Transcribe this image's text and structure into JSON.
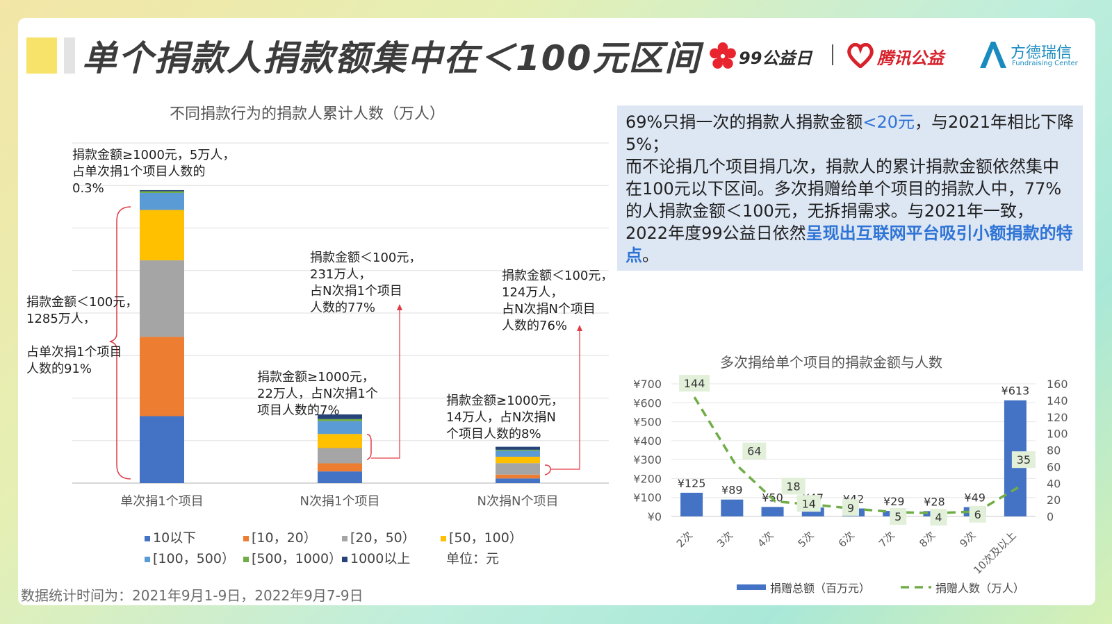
{
  "page": {
    "title": "单个捐款人捐款额集中在＜100元区间",
    "logos": {
      "text_99": "99公益日",
      "text_tencent": "腾讯公益",
      "text_fd": "方德瑞信",
      "text_fd_en": "Fundraising Center"
    },
    "footer": "数据统计时间为：2021年9月1-9日，2022年9月7-9日"
  },
  "summary_box": {
    "line1_a": "69%只捐一次的捐款人捐款金额",
    "line1_hl": "<20元",
    "line1_b": "，与2021年相比下降5%；",
    "line2_a": "而不论捐几个项目捐几次，捐款人的累计捐款金额依然集中在100元以下区间。多次捐赠给单个项目的捐款人中，77%的人捐款金额＜100元，无拆捐需求。与2021年一致，2022年度99公益日依然",
    "line2_hl": "呈现出互联网平台吸引小额捐款的特点",
    "line2_end": "。",
    "colors": {
      "box_bg": "#dde6f3",
      "highlight": "#2e74d6"
    }
  },
  "left_chart_text": {
    "title": "不同捐款行为的捐款人累计人数（万人）",
    "unit_label": "单位：元",
    "annotations": {
      "a1": "捐款金额≥1000元，5万人，\n占单次捐1个项目人数的\n0.3%",
      "a2": "捐款金额＜100元，\n1285万人，",
      "a3": "占单次捐1个项目\n人数的91%",
      "a4": "捐款金额＜100元，\n231万人，\n占N次捐1个项目\n人数的77%",
      "a5": "捐款金额≥1000元，\n22万人，占N次捐1个\n项目人数的7%",
      "a6": "捐款金额＜100元，\n124万人，\n占N次捐N个项目\n人数的76%",
      "a7": "捐款金额≥1000元，\n14万人，占N次捐N\n个项目人数的8%"
    }
  },
  "right_chart_text": {
    "title": "多次捐给单个项目的捐款金额与人数"
  },
  "chart_data": [
    {
      "type": "bar",
      "stacked": true,
      "title": "不同捐款行为的捐款人累计人数（万人）",
      "categories": [
        "单次捐1个项目",
        "N次捐1个项目",
        "N次捐N个项目"
      ],
      "series": [
        {
          "name": "10以下",
          "color": "#4472c4",
          "values": [
            315,
            55,
            22
          ]
        },
        {
          "name": "[10，20）",
          "color": "#ed7d31",
          "values": [
            373,
            38,
            18
          ]
        },
        {
          "name": "[20，50）",
          "color": "#a5a5a5",
          "values": [
            360,
            72,
            54
          ]
        },
        {
          "name": "[50，100）",
          "color": "#ffc000",
          "values": [
            237,
            66,
            30
          ]
        },
        {
          "name": "[100，500）",
          "color": "#5b9bd5",
          "values": [
            80,
            60,
            28
          ]
        },
        {
          "name": "[500，1000）",
          "color": "#70ad47",
          "values": [
            8,
            10,
            5
          ]
        },
        {
          "name": "1000以上",
          "color": "#264478",
          "values": [
            5,
            22,
            14
          ]
        }
      ],
      "ylim": [
        0,
        1600
      ],
      "grid": true,
      "legend": "bottom"
    },
    {
      "type": "bar",
      "title": "多次捐给单个项目的捐款金额与人数",
      "categories": [
        "2次",
        "3次",
        "4次",
        "5次",
        "6次",
        "7次",
        "8次",
        "9次",
        "10次及以上"
      ],
      "series": [
        {
          "name": "捐赠总额（百万元）",
          "type": "bar",
          "axis": "left",
          "color": "#4472c4",
          "values": [
            125,
            89,
            50,
            47,
            42,
            29,
            28,
            49,
            613
          ],
          "labels": [
            "¥125",
            "¥89",
            "¥50",
            "¥47",
            "¥42",
            "¥29",
            "¥28",
            "¥49",
            "¥613"
          ]
        },
        {
          "name": "捐赠人数（万人）",
          "type": "line",
          "style": "dashed",
          "axis": "right",
          "color": "#70ad47",
          "values": [
            144,
            64,
            18,
            14,
            9,
            5,
            4,
            6,
            35
          ]
        }
      ],
      "y_left": {
        "lim": [
          0,
          700
        ],
        "ticks": [
          "¥0",
          "¥100",
          "¥200",
          "¥300",
          "¥400",
          "¥500",
          "¥600",
          "¥700"
        ]
      },
      "y_right": {
        "lim": [
          0,
          160
        ],
        "ticks": [
          "0",
          "20",
          "40",
          "60",
          "80",
          "100",
          "120",
          "140",
          "160"
        ]
      },
      "grid": true,
      "legend": "bottom"
    }
  ]
}
